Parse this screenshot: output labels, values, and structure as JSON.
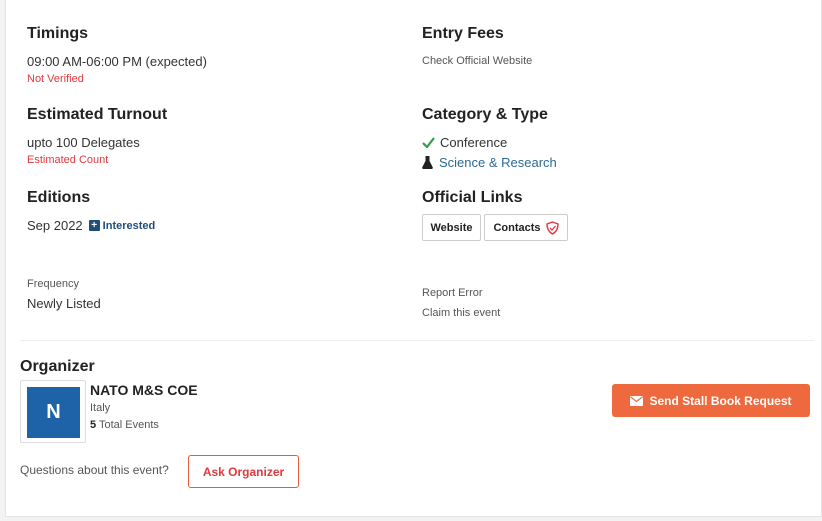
{
  "timings": {
    "heading": "Timings",
    "value": "09:00 AM-06:00 PM (expected)",
    "status": "Not Verified"
  },
  "turnout": {
    "heading": "Estimated Turnout",
    "value": "upto 100 Delegates",
    "status": "Estimated Count"
  },
  "editions": {
    "heading": "Editions",
    "date": "Sep 2022",
    "interested_label": "Interested",
    "interested_icon": "plus-square-icon"
  },
  "frequency": {
    "label": "Frequency",
    "value": "Newly Listed"
  },
  "entry_fees": {
    "heading": "Entry Fees",
    "value": "Check Official Website"
  },
  "category": {
    "heading": "Category & Type",
    "items": [
      {
        "label": "Conference",
        "icon": "checkmark-icon",
        "color": "#2e9c4a"
      },
      {
        "label": "Science & Research",
        "icon": "flask-icon",
        "color": "#2c6a94"
      }
    ]
  },
  "official_links": {
    "heading": "Official Links",
    "website_label": "Website",
    "contacts_label": "Contacts",
    "contacts_icon": "shield-icon"
  },
  "actions": {
    "report_error": "Report Error",
    "claim_event": "Claim this event"
  },
  "organizer": {
    "heading": "Organizer",
    "avatar_letter": "N",
    "name": "NATO M&S COE",
    "country": "Italy",
    "events_count": "5",
    "events_label": "Total Events",
    "questions_text": "Questions about this event?",
    "ask_button": "Ask Organizer",
    "send_button": "Send Stall Book Request",
    "send_icon": "envelope-icon"
  },
  "colors": {
    "accent_orange": "#ee6a3e",
    "error_red": "#e0393e",
    "link_blue": "#2c6a94",
    "avatar_blue": "#1e63a7"
  }
}
